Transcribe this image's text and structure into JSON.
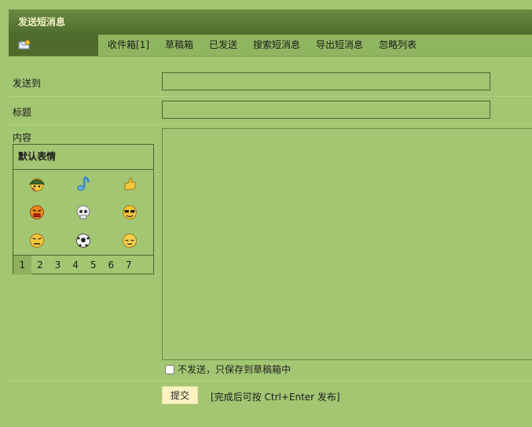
{
  "window": {
    "title": "发送短消息"
  },
  "nav": {
    "home_icon": "mail-icon",
    "tabs": [
      "收件箱[1]",
      "草稿箱",
      "已发送",
      "搜索短消息",
      "导出短消息",
      "忽略列表"
    ]
  },
  "form": {
    "to_label": "发送到",
    "to_value": "",
    "subject_label": "标题",
    "subject_value": "",
    "content_label": "内容",
    "content_value": ""
  },
  "smilies": {
    "title": "默认表情",
    "icons": [
      "army-helmet-smiley-icon",
      "music-note-smiley-icon",
      "thumbs-up-icon",
      "angry-smiley-icon",
      "skull-icon",
      "sunglasses-smiley-icon",
      "annoyed-smiley-icon",
      "soccer-ball-icon",
      "sleepy-smiley-icon"
    ],
    "pages": [
      "1",
      "2",
      "3",
      "4",
      "5",
      "6",
      "7"
    ],
    "active_page": "1"
  },
  "draft_option": {
    "label": "不发送，只保存到草稿箱中",
    "checked": false
  },
  "submit": {
    "label": "提交",
    "hint": "[完成后可按 Ctrl+Enter 发布]"
  },
  "colors": {
    "background": "#a3c672",
    "title_bar": "#5a7a36",
    "title_text": "#f4f0c8",
    "button": "#fdf3c2"
  }
}
